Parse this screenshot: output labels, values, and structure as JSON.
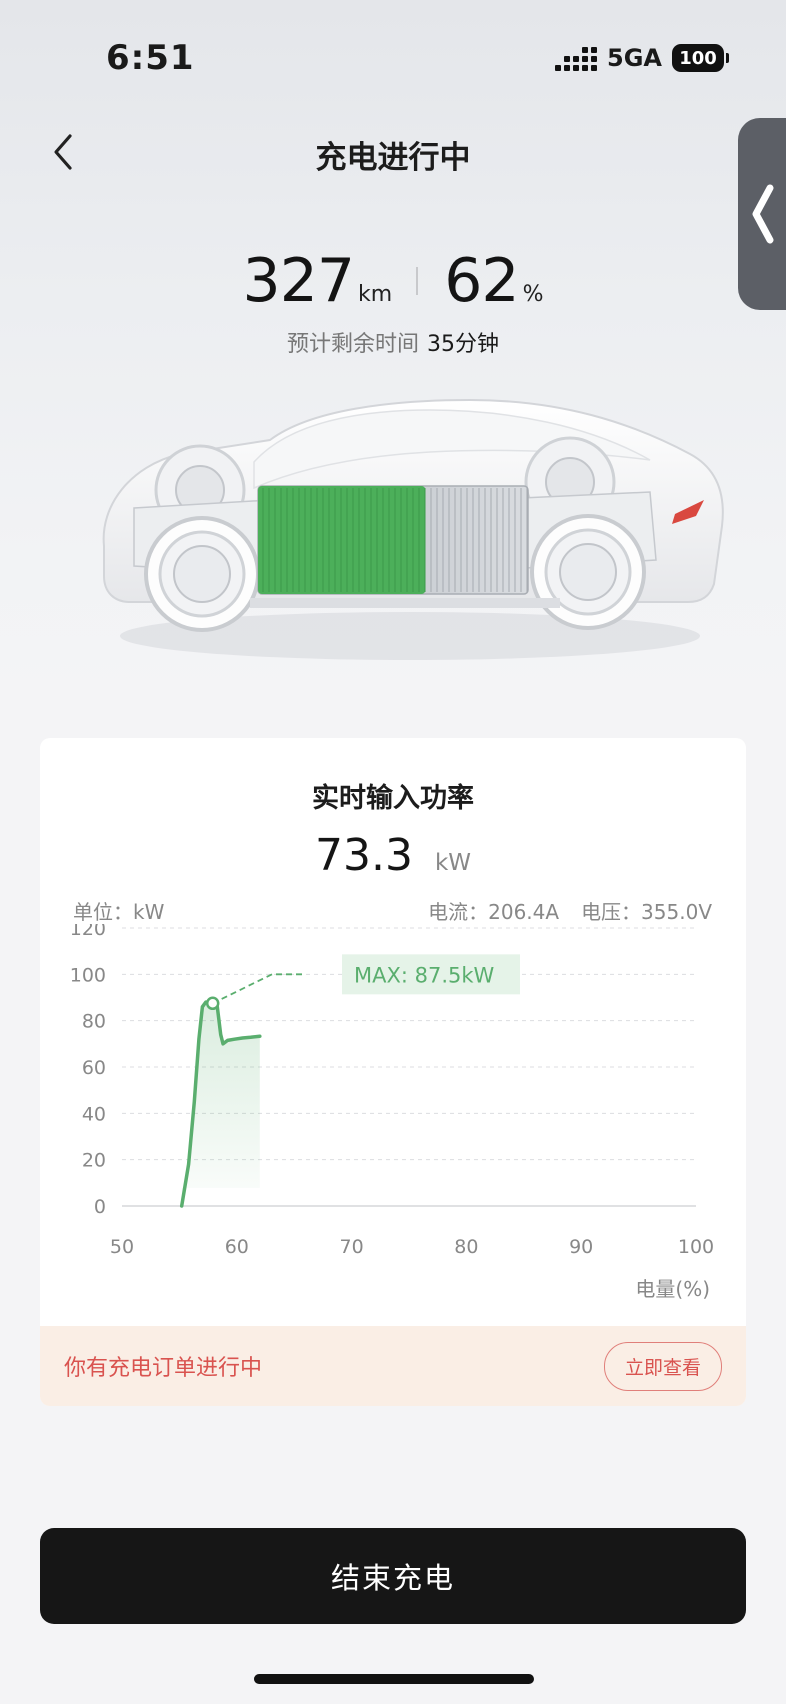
{
  "status_bar": {
    "time": "6:51",
    "network": "5GA",
    "battery": "100"
  },
  "nav": {
    "title": "充电进行中",
    "back_icon": "chevron-left-icon",
    "side_tab_icon": "chevron-left-icon"
  },
  "summary": {
    "range_value": "327",
    "range_unit": "km",
    "soc_value": "62",
    "soc_unit": "%",
    "remaining_label": "预计剩余时间",
    "remaining_value": "35分钟"
  },
  "battery_fill_fraction": 0.62,
  "power_card": {
    "title": "实时输入功率",
    "value": "73.3",
    "unit": "kW",
    "unit_label": "单位：kW",
    "current": "电流：206.4A",
    "voltage": "电压：355.0V",
    "max_label": "MAX: 87.5kW"
  },
  "chart_data": {
    "type": "line",
    "xlabel": "电量(%)",
    "ylabel": "",
    "x_ticks": [
      "50",
      "60",
      "70",
      "80",
      "90",
      "100"
    ],
    "y_ticks": [
      "0",
      "20",
      "40",
      "60",
      "80",
      "100",
      "120"
    ],
    "xlim": [
      50,
      100
    ],
    "ylim": [
      0,
      120
    ],
    "grid": true,
    "series": [
      {
        "x": [
          55.2,
          55.8,
          56.3,
          56.7,
          57.0,
          57.3,
          57.6,
          57.9,
          58.3,
          58.6,
          58.8,
          59.2,
          59.8,
          60.5,
          61.2,
          62.0
        ],
        "y": [
          0,
          18,
          45,
          72,
          86,
          88,
          88,
          87.5,
          86,
          74,
          70,
          71.5,
          72,
          72.5,
          72.8,
          73.3
        ]
      }
    ],
    "max_point": {
      "x": 57.9,
      "y": 87.5,
      "label": "MAX: 87.5kW"
    },
    "line_color": "#5aae6e"
  },
  "order": {
    "text": "你有充电订单进行中",
    "button": "立即查看"
  },
  "end_button": "结束充电",
  "colors": {
    "accent_green": "#5aae6e",
    "warn_red": "#d9534f",
    "order_bg": "#faeee5"
  }
}
